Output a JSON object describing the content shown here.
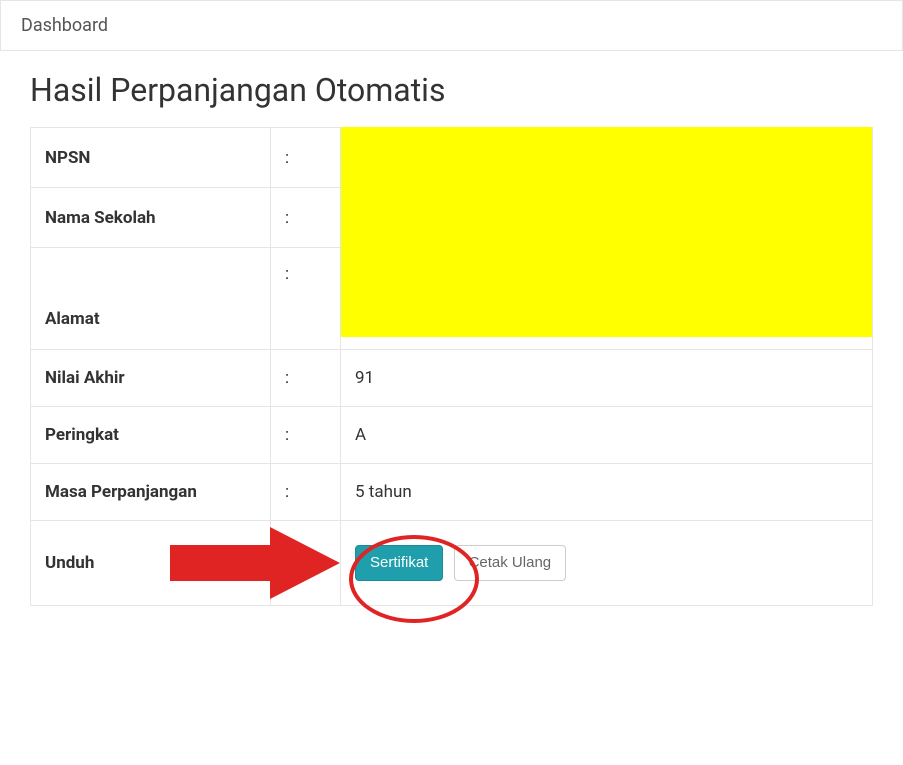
{
  "breadcrumb": "Dashboard",
  "page_title": "Hasil Perpanjangan Otomatis",
  "rows": {
    "npsn": {
      "label": "NPSN",
      "value": ""
    },
    "nama_sekolah": {
      "label": "Nama Sekolah",
      "value": ""
    },
    "alamat": {
      "label": "Alamat",
      "value": ""
    },
    "nilai_akhir": {
      "label": "Nilai Akhir",
      "value": "91"
    },
    "peringkat": {
      "label": "Peringkat",
      "value": "A"
    },
    "masa_perpanjangan": {
      "label": "Masa Perpanjangan",
      "value": "5 tahun"
    },
    "unduh": {
      "label": "Unduh"
    }
  },
  "buttons": {
    "sertifikat": "Sertifikat",
    "cetak_ulang": "Cetak Ulang"
  },
  "colon": ":"
}
